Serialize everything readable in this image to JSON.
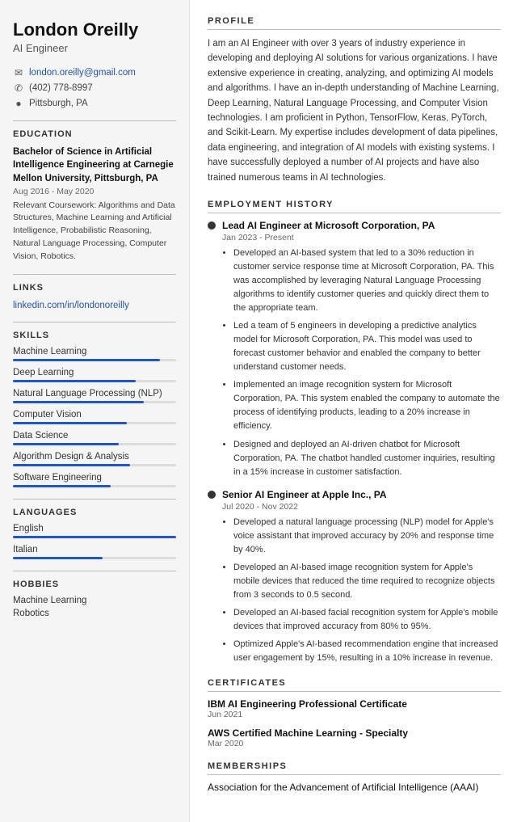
{
  "sidebar": {
    "name": "London Oreilly",
    "title": "AI Engineer",
    "contact": {
      "email": "london.oreilly@gmail.com",
      "phone": "(402) 778-8997",
      "location": "Pittsburgh, PA"
    },
    "education": {
      "section_title": "EDUCATION",
      "degree": "Bachelor of Science in Artificial Intelligence Engineering at Carnegie Mellon University, Pittsburgh, PA",
      "dates": "Aug 2016 - May 2020",
      "coursework": "Relevant Coursework: Algorithms and Data Structures, Machine Learning and Artificial Intelligence, Probabilistic Reasoning, Natural Language Processing, Computer Vision, Robotics."
    },
    "links": {
      "section_title": "LINKS",
      "url_text": "linkedin.com/in/londonoreilly",
      "url_href": "#"
    },
    "skills": {
      "section_title": "SKILLS",
      "items": [
        {
          "label": "Machine Learning",
          "pct": 90
        },
        {
          "label": "Deep Learning",
          "pct": 75
        },
        {
          "label": "Natural Language Processing (NLP)",
          "pct": 80
        },
        {
          "label": "Computer Vision",
          "pct": 70
        },
        {
          "label": "Data Science",
          "pct": 65
        },
        {
          "label": "Algorithm Design & Analysis",
          "pct": 72
        },
        {
          "label": "Software Engineering",
          "pct": 60
        }
      ]
    },
    "languages": {
      "section_title": "LANGUAGES",
      "items": [
        {
          "label": "English",
          "pct": 100
        },
        {
          "label": "Italian",
          "pct": 55
        }
      ]
    },
    "hobbies": {
      "section_title": "HOBBIES",
      "items": [
        "Machine Learning",
        "Robotics"
      ]
    }
  },
  "main": {
    "profile": {
      "section_title": "PROFILE",
      "text": "I am an AI Engineer with over 3 years of industry experience in developing and deploying AI solutions for various organizations. I have extensive experience in creating, analyzing, and optimizing AI models and algorithms. I have an in-depth understanding of Machine Learning, Deep Learning, Natural Language Processing, and Computer Vision technologies. I am proficient in Python, TensorFlow, Keras, PyTorch, and Scikit-Learn. My expertise includes development of data pipelines, data engineering, and integration of AI models with existing systems. I have successfully deployed a number of AI projects and have also trained numerous teams in AI technologies."
    },
    "employment": {
      "section_title": "EMPLOYMENT HISTORY",
      "jobs": [
        {
          "title": "Lead AI Engineer at Microsoft Corporation, PA",
          "dates": "Jan 2023 - Present",
          "bullets": [
            "Developed an AI-based system that led to a 30% reduction in customer service response time at Microsoft Corporation, PA. This was accomplished by leveraging Natural Language Processing algorithms to identify customer queries and quickly direct them to the appropriate team.",
            "Led a team of 5 engineers in developing a predictive analytics model for Microsoft Corporation, PA. This model was used to forecast customer behavior and enabled the company to better understand customer needs.",
            "Implemented an image recognition system for Microsoft Corporation, PA. This system enabled the company to automate the process of identifying products, leading to a 20% increase in efficiency.",
            "Designed and deployed an AI-driven chatbot for Microsoft Corporation, PA. The chatbot handled customer inquiries, resulting in a 15% increase in customer satisfaction."
          ]
        },
        {
          "title": "Senior AI Engineer at Apple Inc., PA",
          "dates": "Jul 2020 - Nov 2022",
          "bullets": [
            "Developed a natural language processing (NLP) model for Apple's voice assistant that improved accuracy by 20% and response time by 40%.",
            "Developed an AI-based image recognition system for Apple's mobile devices that reduced the time required to recognize objects from 3 seconds to 0.5 second.",
            "Developed an AI-based facial recognition system for Apple's mobile devices that improved accuracy from 80% to 95%.",
            "Optimized Apple's AI-based recommendation engine that increased user engagement by 15%, resulting in a 10% increase in revenue."
          ]
        }
      ]
    },
    "certificates": {
      "section_title": "CERTIFICATES",
      "items": [
        {
          "name": "IBM AI Engineering Professional Certificate",
          "date": "Jun 2021"
        },
        {
          "name": "AWS Certified Machine Learning - Specialty",
          "date": "Mar 2020"
        }
      ]
    },
    "memberships": {
      "section_title": "MEMBERSHIPS",
      "items": [
        "Association for the Advancement of Artificial Intelligence (AAAI)"
      ]
    }
  }
}
